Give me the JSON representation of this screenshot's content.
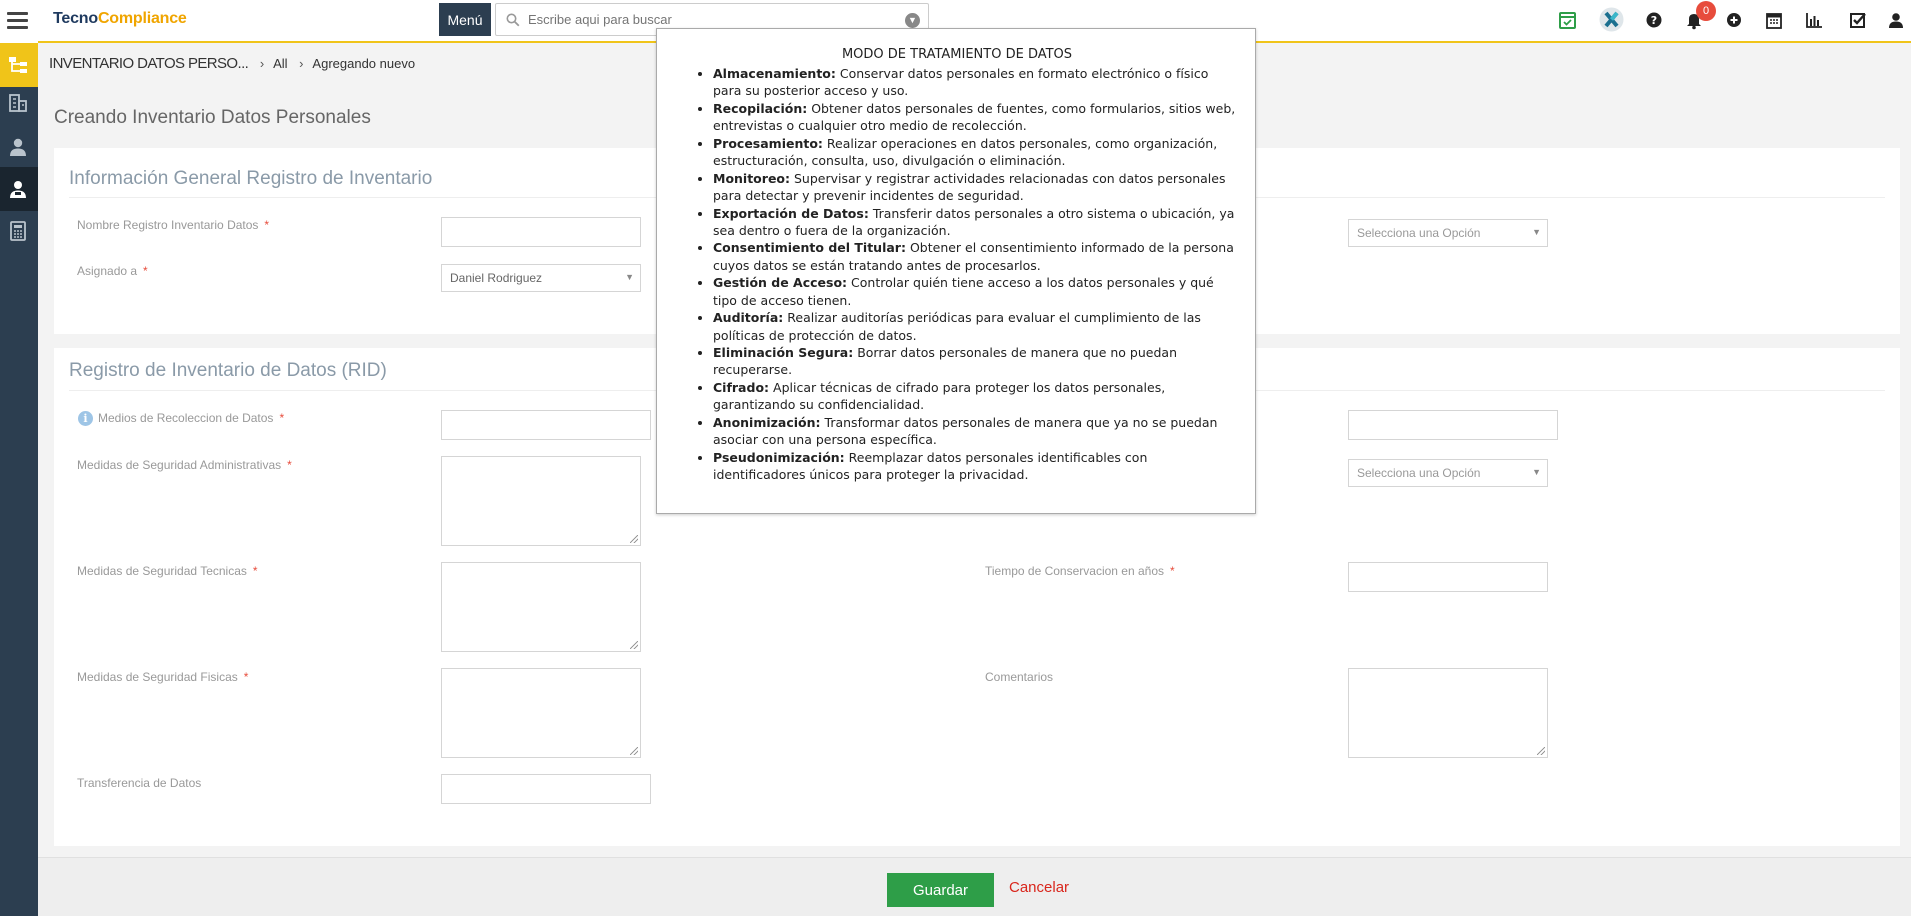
{
  "app": {
    "logo_part1": "Tecno",
    "logo_part2": "Compliance",
    "menu_label": "Menú",
    "search_placeholder": "Escribe aqui para buscar",
    "notification_count": "0"
  },
  "topbar_icons": [
    "calendar-check-icon",
    "brand-x-icon",
    "help-icon",
    "bell-icon",
    "plus-circle-icon",
    "calendar-icon",
    "bar-chart-icon",
    "checkbox-icon",
    "user-icon"
  ],
  "sidebar_icons": [
    "org-chart-icon",
    "building-icon",
    "user-icon",
    "user-card-icon",
    "calculator-icon"
  ],
  "breadcrumb": {
    "module": "INVENTARIO DATOS PERSO...",
    "all": "All",
    "current": "Agregando nuevo"
  },
  "page_title": "Creando Inventario Datos Personales",
  "section1": {
    "title": "Información General Registro de Inventario",
    "name_label": "Nombre Registro Inventario Datos",
    "assigned_label": "Asignado a",
    "assigned_value": "Daniel Rodriguez",
    "select_placeholder": "Selecciona una Opción"
  },
  "section2": {
    "title": "Registro de Inventario de Datos (RID)",
    "medios_label": "Medios de Recoleccion de Datos",
    "admin_label": "Medidas de Seguridad Administrativas",
    "tecnicas_label": "Medidas de Seguridad Tecnicas",
    "fisicas_label": "Medidas de Seguridad Fisicas",
    "transfer_label": "Transferencia de Datos",
    "conservacion_label": "Tiempo de Conservacion en años",
    "comentarios_label": "Comentarios",
    "select_placeholder": "Selecciona una Opción"
  },
  "footer": {
    "save_label": "Guardar",
    "cancel_label": "Cancelar"
  },
  "popup": {
    "title": "MODO DE TRATAMIENTO DE DATOS",
    "items": [
      {
        "term": "Almacenamiento:",
        "desc": "Conservar datos personales en formato electrónico o físico para su posterior acceso y uso."
      },
      {
        "term": "Recopilación:",
        "desc": "Obtener datos personales de fuentes, como formularios, sitios web, entrevistas o cualquier otro medio de recolección."
      },
      {
        "term": "Procesamiento:",
        "desc": "Realizar operaciones en datos personales, como organización, estructuración, consulta, uso, divulgación o eliminación."
      },
      {
        "term": "Monitoreo:",
        "desc": "Supervisar y registrar actividades relacionadas con datos personales para detectar y prevenir incidentes de seguridad."
      },
      {
        "term": "Exportación de Datos:",
        "desc": "Transferir datos personales a otro sistema o ubicación, ya sea dentro o fuera de la organización."
      },
      {
        "term": "Consentimiento del Titular:",
        "desc": "Obtener el consentimiento informado de la persona cuyos datos se están tratando antes de procesarlos."
      },
      {
        "term": "Gestión de Acceso:",
        "desc": "Controlar quién tiene acceso a los datos personales y qué tipo de acceso tienen."
      },
      {
        "term": "Auditoría:",
        "desc": "Realizar auditorías periódicas para evaluar el cumplimiento de las políticas de protección de datos."
      },
      {
        "term": "Eliminación Segura:",
        "desc": "Borrar datos personales de manera que no puedan recuperarse."
      },
      {
        "term": "Cifrado:",
        "desc": "Aplicar técnicas de cifrado para proteger los datos personales, garantizando su confidencialidad."
      },
      {
        "term": "Anonimización:",
        "desc": "Transformar datos personales de manera que ya no se puedan asociar con una persona específica."
      },
      {
        "term": "Pseudonimización:",
        "desc": "Reemplazar datos personales identificables con identificadores únicos para proteger la privacidad."
      }
    ]
  },
  "colors": {
    "accent": "#f0c419",
    "sidebar": "#2c3e50",
    "save": "#2e9e48",
    "cancel": "#d9261c",
    "required": "#e74c3c"
  }
}
